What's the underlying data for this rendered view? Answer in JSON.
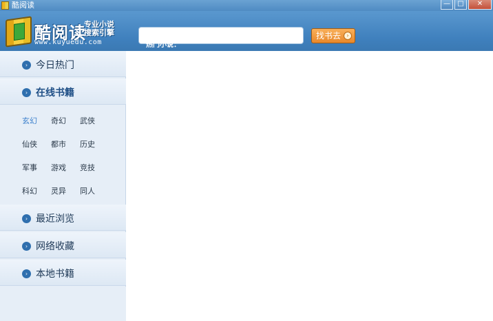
{
  "window": {
    "title": "酷阅读",
    "min_symbol": "—",
    "max_symbol": "□",
    "close_symbol": "✕"
  },
  "header": {
    "logo_name": "酷阅读",
    "logo_slogan_line1": "专业小说",
    "logo_slogan_line2": "搜索引擎",
    "logo_url": "www.kuyuedu.com",
    "search_placeholder": "",
    "search_value": "",
    "search_button_label": "找书去",
    "search_button_icon": "go-arrow-icon",
    "search_button_glyph": "›",
    "hot_label": "热门小说："
  },
  "sidebar": {
    "items": [
      {
        "label": "今日热门",
        "icon": "arrow-circle-icon",
        "glyph": "›"
      },
      {
        "label": "在线书籍",
        "icon": "arrow-circle-icon",
        "glyph": "›",
        "active": true
      },
      {
        "label": "最近浏览",
        "icon": "arrow-circle-icon",
        "glyph": "›"
      },
      {
        "label": "网络收藏",
        "icon": "arrow-circle-icon",
        "glyph": "›"
      },
      {
        "label": "本地书籍",
        "icon": "arrow-circle-icon",
        "glyph": "›"
      }
    ],
    "categories": [
      [
        "玄幻",
        "奇幻",
        "武侠"
      ],
      [
        "仙侠",
        "都市",
        "历史"
      ],
      [
        "军事",
        "游戏",
        "竞技"
      ],
      [
        "科幻",
        "灵异",
        "同人"
      ]
    ],
    "selected_category": "玄幻"
  },
  "colors": {
    "header_blue": "#4f8bc3",
    "sidebar_bg": "#e6eef7",
    "button_orange": "#e9882a",
    "selected_category": "#3a7fcc"
  }
}
